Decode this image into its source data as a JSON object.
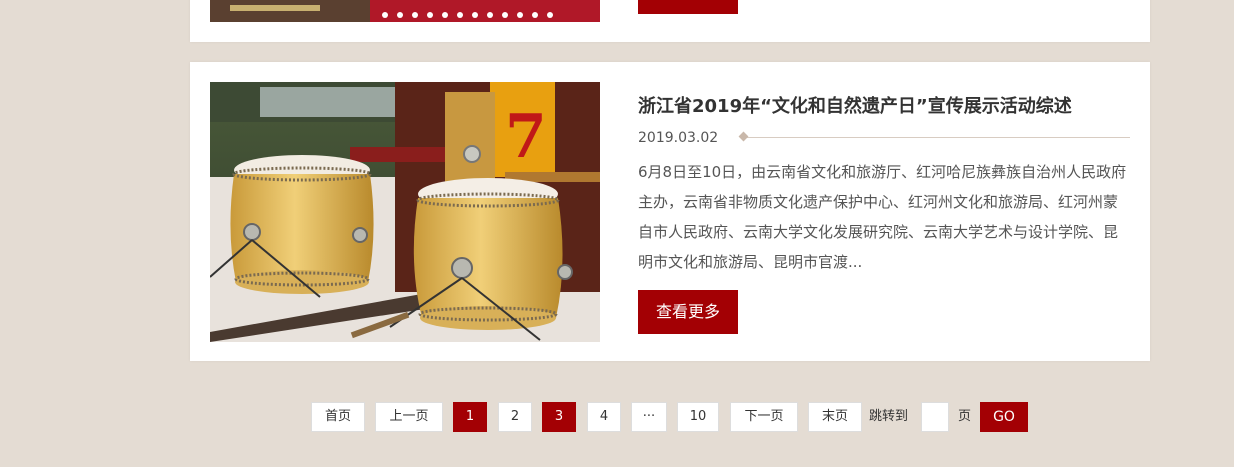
{
  "article": {
    "title": "浙江省2019年“文化和自然遗产日”宣传展示活动综述",
    "date": "2019.03.02",
    "summary": "6月8日至10日，由云南省文化和旅游厅、红河哈尼族彝族自治州人民政府主办，云南省非物质文化遗产保护中心、红河州文化和旅游局、红河州蒙自市人民政府、云南大学文化发展研究院、云南大学艺术与设计学院、昆明市文化和旅游局、昆明市官渡...",
    "more_label": "查看更多",
    "image_alt": "drums-on-dragon-boat",
    "boat_number": "7"
  },
  "pagination": {
    "first": "首页",
    "prev": "上一页",
    "pages": [
      "1",
      "2",
      "3",
      "4",
      "···",
      "10"
    ],
    "next": "下一页",
    "last": "末页",
    "jump_label": "跳转到",
    "page_unit": "页",
    "go": "GO"
  },
  "colors": {
    "background": "#e4dcd3",
    "accent": "#a30004",
    "card": "#ffffff"
  }
}
